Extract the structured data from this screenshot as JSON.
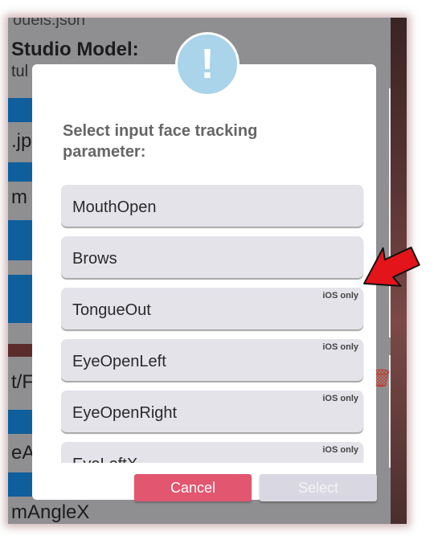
{
  "background": {
    "file_fragment": "ouels.json",
    "studio_model_label": "Studio Model:",
    "stub_fragment": "tul",
    "jpg_fragment": ".jp",
    "m_fragment": "m",
    "tf_fragment": "t/F",
    "ea_fragment": "eA",
    "anglex_fragment": "mAngleX"
  },
  "modal": {
    "icon_glyph": "!",
    "title": "Select input face tracking parameter:",
    "options": [
      {
        "label": "MouthOpen",
        "badge": ""
      },
      {
        "label": "Brows",
        "badge": ""
      },
      {
        "label": "TongueOut",
        "badge": "iOS only"
      },
      {
        "label": "EyeOpenLeft",
        "badge": "iOS only"
      },
      {
        "label": "EyeOpenRight",
        "badge": "iOS only"
      },
      {
        "label": "EyeLeftX",
        "badge": "iOS only"
      }
    ],
    "cancel_label": "Cancel",
    "select_label": "Select"
  },
  "colors": {
    "cancel": "#e2566f",
    "select_disabled": "#d9d8e2",
    "icon_badge": "#a9d4ea",
    "annotation_arrow": "#e3141a"
  }
}
